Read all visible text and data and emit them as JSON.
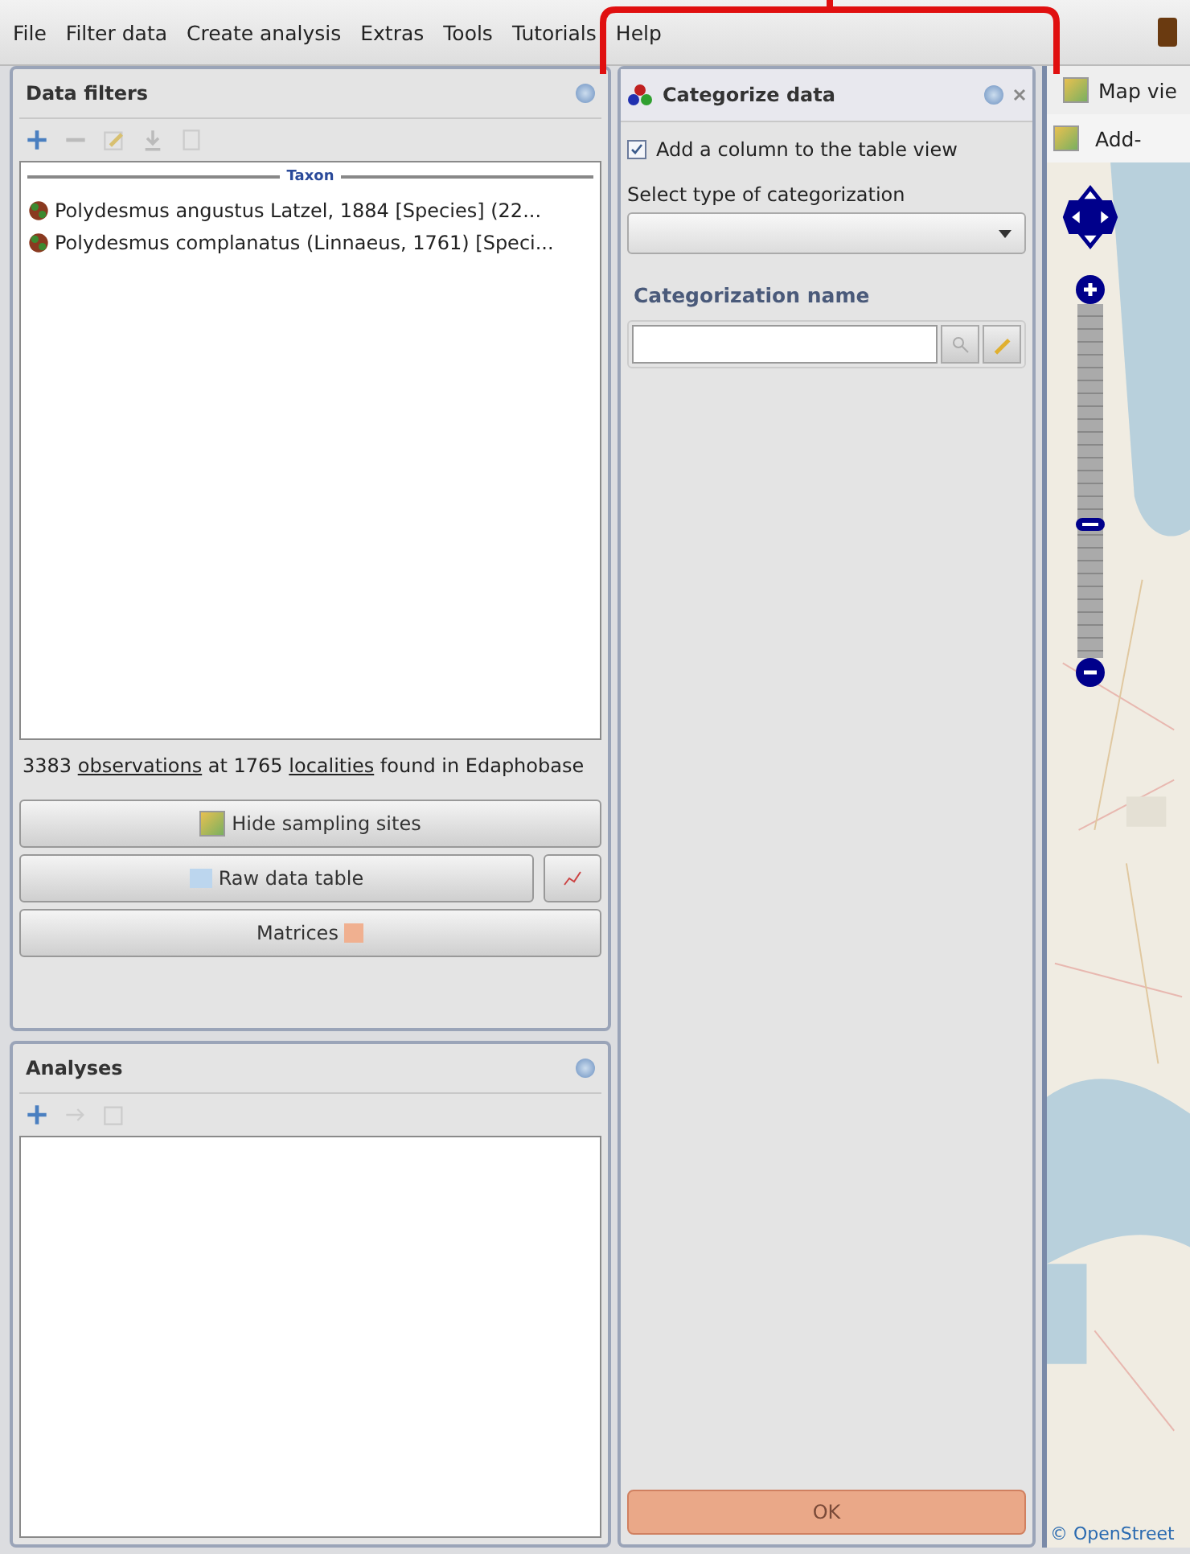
{
  "menu": [
    {
      "label": "File"
    },
    {
      "label": "Filter data"
    },
    {
      "label": "Create analysis"
    },
    {
      "label": "Extras"
    },
    {
      "label": "Tools"
    },
    {
      "label": "Tutorials"
    },
    {
      "label": "Help"
    }
  ],
  "data_filters": {
    "title": "Data filters",
    "group_header": "Taxon",
    "items": [
      {
        "label": "Polydesmus angustus Latzel, 1884 [Species] (22..."
      },
      {
        "label": "Polydesmus complanatus (Linnaeus, 1761) [Speci..."
      }
    ],
    "summary": [
      {
        "text": "3383 ",
        "link": false
      },
      {
        "text": "observations",
        "link": true
      },
      {
        "text": " at 1765 ",
        "link": false
      },
      {
        "text": "localities",
        "link": true
      },
      {
        "text": " found in Edaphobase",
        "link": false
      }
    ],
    "buttons": {
      "hide_sites": "Hide sampling sites",
      "raw_table": "Raw data table",
      "matrices": "Matrices"
    }
  },
  "analyses": {
    "title": "Analyses"
  },
  "categorize": {
    "title": "Categorize data",
    "checkbox": {
      "label": "Add a column to the table view",
      "checked": true
    },
    "select_label": "Select type of categorization",
    "name_label": "Categorization name",
    "ok": {
      "label": "OK",
      "disabled": true
    }
  },
  "map": {
    "tab_label": "Map vie",
    "toolbar_label": "Add-",
    "attribution": "© OpenStreet",
    "zoom": {
      "level": 0.36
    }
  }
}
